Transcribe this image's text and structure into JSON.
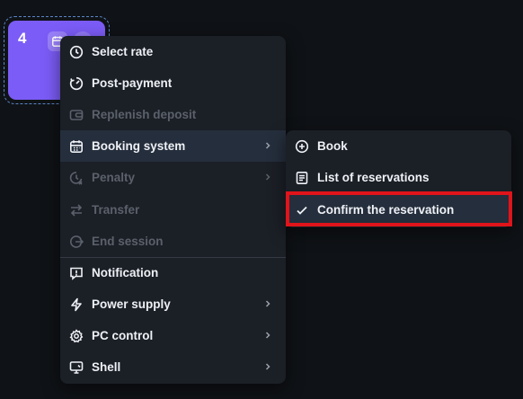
{
  "tile": {
    "number": "4"
  },
  "main_menu": {
    "items": [
      {
        "label": "Select rate",
        "icon": "clock-icon",
        "disabled": false,
        "has_submenu": false
      },
      {
        "label": "Post-payment",
        "icon": "timer-icon",
        "disabled": false,
        "has_submenu": false
      },
      {
        "label": "Replenish deposit",
        "icon": "wallet-icon",
        "disabled": true,
        "has_submenu": false
      },
      {
        "label": "Booking system",
        "icon": "calendar-icon",
        "disabled": false,
        "has_submenu": true,
        "active": true
      },
      {
        "label": "Penalty",
        "icon": "penalty-clock-icon",
        "disabled": true,
        "has_submenu": true
      },
      {
        "label": "Transfer",
        "icon": "transfer-icon",
        "disabled": true,
        "has_submenu": false
      },
      {
        "label": "End session",
        "icon": "exit-icon",
        "disabled": true,
        "has_submenu": false
      },
      {
        "label": "Notification",
        "icon": "message-alert-icon",
        "disabled": false,
        "has_submenu": false
      },
      {
        "label": "Power supply",
        "icon": "lightning-icon",
        "disabled": false,
        "has_submenu": true
      },
      {
        "label": "PC control",
        "icon": "gear-icon",
        "disabled": false,
        "has_submenu": true
      },
      {
        "label": "Shell",
        "icon": "monitor-icon",
        "disabled": false,
        "has_submenu": true
      }
    ]
  },
  "sub_menu": {
    "items": [
      {
        "label": "Book",
        "icon": "plus-circle-icon"
      },
      {
        "label": "List of reservations",
        "icon": "list-icon"
      },
      {
        "label": "Confirm the reservation",
        "icon": "check-icon",
        "highlighted": true
      }
    ]
  },
  "colors": {
    "tile": "#7b5cf6",
    "menu_bg": "#1b1f26",
    "active_row": "#252e3c",
    "highlight": "#e0141a"
  }
}
